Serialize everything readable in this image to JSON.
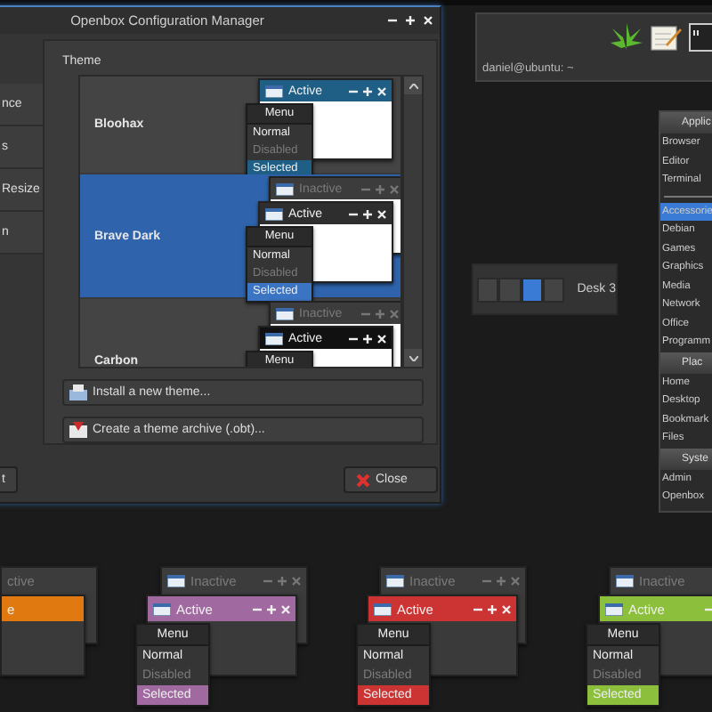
{
  "config_window": {
    "title": "Openbox Configuration Manager",
    "sidebar": [
      {
        "label": "nce"
      },
      {
        "label": "s"
      },
      {
        "label": "Resize"
      },
      {
        "label": "n"
      }
    ],
    "theme_heading": "Theme",
    "themes": [
      {
        "name": "Bloohax",
        "selected": false,
        "preview": {
          "active_title": "Active",
          "menu_title": "Menu",
          "menu_items": [
            {
              "label": "Normal",
              "kind": "normal"
            },
            {
              "label": "Disabled",
              "kind": "disabled"
            },
            {
              "label": "Selected",
              "kind": "selected",
              "color": "#1f5f86"
            }
          ],
          "color": "#1f5f86"
        }
      },
      {
        "name": "Brave Dark",
        "selected": true,
        "preview": {
          "inactive_title": "Inactive",
          "active_title": "Active",
          "menu_title": "Menu",
          "menu_items": [
            {
              "label": "Normal",
              "kind": "normal"
            },
            {
              "label": "Disabled",
              "kind": "disabled"
            },
            {
              "label": "Selected",
              "kind": "selected",
              "color": "#3b74c2"
            }
          ],
          "color": "#2e2e2e"
        }
      },
      {
        "name": "Carbon",
        "selected": false,
        "preview": {
          "inactive_title": "Inactive",
          "active_title": "Active",
          "menu_title": "Menu",
          "color": "#111111"
        }
      }
    ],
    "install_button": "Install a new theme...",
    "archive_button": "Create a theme archive (.obt)...",
    "footer_button": "t",
    "close_button": "Close"
  },
  "panel": {
    "status": "daniel@ubuntu: ~"
  },
  "pager": {
    "desks": [
      {
        "selected": false
      },
      {
        "selected": false
      },
      {
        "selected": true
      },
      {
        "selected": false
      }
    ],
    "label": "Desk 3"
  },
  "app_menu": {
    "sections": [
      {
        "title": "Applic",
        "items": [
          {
            "label": "Browser",
            "selected": false
          },
          {
            "label": "Editor",
            "selected": false
          },
          {
            "label": "Terminal",
            "selected": false
          }
        ]
      },
      {
        "items": [
          {
            "label": "Accessorie",
            "selected": true
          },
          {
            "label": "Debian",
            "selected": false
          },
          {
            "label": "Games",
            "selected": false
          },
          {
            "label": "Graphics",
            "selected": false
          },
          {
            "label": "Media",
            "selected": false
          },
          {
            "label": "Network",
            "selected": false
          },
          {
            "label": "Office",
            "selected": false
          },
          {
            "label": "Programm",
            "selected": false
          }
        ]
      },
      {
        "title": "Plac",
        "items": [
          {
            "label": "Home",
            "selected": false
          },
          {
            "label": "Desktop",
            "selected": false
          },
          {
            "label": "Bookmark",
            "selected": false
          },
          {
            "label": "Files",
            "selected": false
          }
        ]
      },
      {
        "title": "Syste",
        "items": [
          {
            "label": "Admin",
            "selected": false
          },
          {
            "label": "Openbox",
            "selected": false
          }
        ]
      }
    ]
  },
  "theme_previews": [
    {
      "inactive_title": "ctive",
      "active_title": "e",
      "color": "#e07a10"
    },
    {
      "inactive_title": "Inactive",
      "active_title": "Active",
      "menu_title": "Menu",
      "menu_items": [
        {
          "label": "Normal",
          "kind": "normal"
        },
        {
          "label": "Disabled",
          "kind": "disabled"
        },
        {
          "label": "Selected",
          "kind": "selected",
          "color": "#a06aa0"
        }
      ],
      "color": "#a06aa0"
    },
    {
      "inactive_title": "Inactive",
      "active_title": "Active",
      "menu_title": "Menu",
      "menu_items": [
        {
          "label": "Normal",
          "kind": "normal"
        },
        {
          "label": "Disabled",
          "kind": "disabled"
        },
        {
          "label": "Selected",
          "kind": "selected",
          "color": "#cc3333"
        }
      ],
      "color": "#cc3333"
    },
    {
      "inactive_title": "Inactive",
      "active_title": "Active",
      "menu_title": "Menu",
      "menu_items": [
        {
          "label": "Normal",
          "kind": "normal"
        },
        {
          "label": "Disabled",
          "kind": "disabled"
        },
        {
          "label": "Selected",
          "kind": "selected",
          "color": "#8cbf3c"
        }
      ],
      "color": "#8cbf3c"
    }
  ]
}
